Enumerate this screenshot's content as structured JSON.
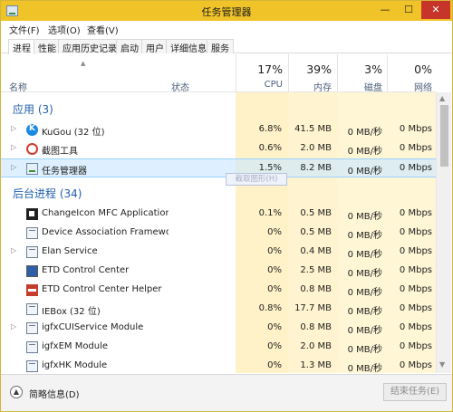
{
  "window": {
    "title": "任务管理器",
    "minimize": "—",
    "maximize": "☐",
    "close": "✕"
  },
  "menu": [
    "文件(F)",
    "选项(O)",
    "查看(V)"
  ],
  "tabs": [
    "进程",
    "性能",
    "应用历史记录",
    "启动",
    "用户",
    "详细信息",
    "服务"
  ],
  "active_tab": "进程",
  "columns": {
    "name": "名称",
    "status": "状态",
    "cpu": {
      "pct": "17%",
      "label": "CPU"
    },
    "mem": {
      "pct": "39%",
      "label": "内存"
    },
    "disk": {
      "pct": "3%",
      "label": "磁盘"
    },
    "net": {
      "pct": "0%",
      "label": "网络"
    }
  },
  "groups": {
    "apps": "应用 (3)",
    "background": "后台进程 (34)"
  },
  "apps": [
    {
      "name": "KuGou (32 位)",
      "cpu": "6.8%",
      "mem": "41.5 MB",
      "disk": "0 MB/秒",
      "net": "0 Mbps",
      "icon": "kugou-icon",
      "expandable": true
    },
    {
      "name": "截图工具",
      "cpu": "0.6%",
      "mem": "2.0 MB",
      "disk": "0 MB/秒",
      "net": "0 Mbps",
      "icon": "snipping-tool-icon",
      "expandable": true
    },
    {
      "name": "任务管理器",
      "cpu": "1.5%",
      "mem": "8.2 MB",
      "disk": "0 MB/秒",
      "net": "0 Mbps",
      "icon": "task-manager-icon",
      "expandable": true,
      "selected": true
    }
  ],
  "background": [
    {
      "name": "ChangeIcon MFC Application...",
      "cpu": "0.1%",
      "mem": "0.5 MB",
      "disk": "0 MB/秒",
      "net": "0 Mbps",
      "icon": "changeicon-icon",
      "expandable": false
    },
    {
      "name": "Device Association Framewo...",
      "cpu": "0%",
      "mem": "0.5 MB",
      "disk": "0 MB/秒",
      "net": "0 Mbps",
      "icon": "service-window-icon",
      "expandable": false
    },
    {
      "name": "Elan Service",
      "cpu": "0%",
      "mem": "0.4 MB",
      "disk": "0 MB/秒",
      "net": "0 Mbps",
      "icon": "service-window-icon",
      "expandable": true
    },
    {
      "name": "ETD Control Center",
      "cpu": "0%",
      "mem": "2.5 MB",
      "disk": "0 MB/秒",
      "net": "0 Mbps",
      "icon": "etd-icon",
      "expandable": false
    },
    {
      "name": "ETD Control Center Helper",
      "cpu": "0%",
      "mem": "0.8 MB",
      "disk": "0 MB/秒",
      "net": "0 Mbps",
      "icon": "etd-helper-icon",
      "expandable": false
    },
    {
      "name": "IEBox (32 位)",
      "cpu": "0.8%",
      "mem": "17.7 MB",
      "disk": "0 MB/秒",
      "net": "0 Mbps",
      "icon": "service-window-icon",
      "expandable": false
    },
    {
      "name": "igfxCUIService Module",
      "cpu": "0%",
      "mem": "0.8 MB",
      "disk": "0 MB/秒",
      "net": "0 Mbps",
      "icon": "service-window-icon",
      "expandable": true
    },
    {
      "name": "igfxEM Module",
      "cpu": "0%",
      "mem": "2.0 MB",
      "disk": "0 MB/秒",
      "net": "0 Mbps",
      "icon": "service-window-icon",
      "expandable": false
    },
    {
      "name": "igfxHK Module",
      "cpu": "0%",
      "mem": "1.3 MB",
      "disk": "0 MB/秒",
      "net": "0 Mbps",
      "icon": "service-window-icon",
      "expandable": false
    }
  ],
  "tooltip": "截取图形(H)",
  "footer": {
    "less_details": "简略信息(D)",
    "end_task": "结束任务(E)"
  },
  "colors": {
    "titlebar": "#f0c428",
    "group_header": "#1f5fad",
    "cpu_highlight": "#fff2c8",
    "selected_row": "#cce8ff"
  }
}
